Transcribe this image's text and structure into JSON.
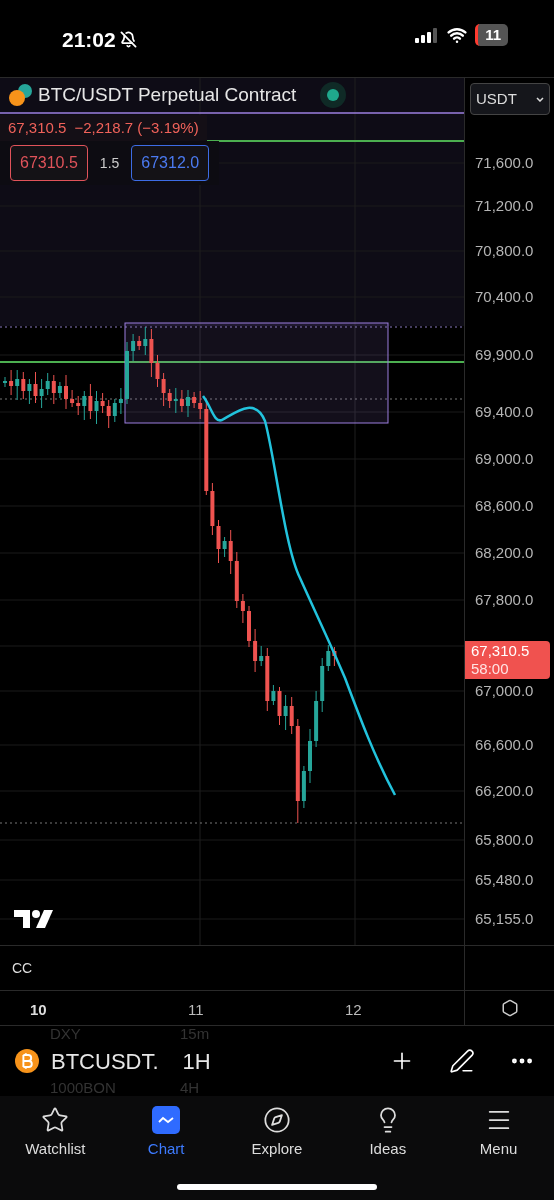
{
  "status_bar": {
    "time": "21:02",
    "battery": "11"
  },
  "chart": {
    "title": "BTC/USDT Perpetual Contract",
    "currency": "USDT",
    "last_price": "67,310.5",
    "change": "−2,218.7 (−3.19%)",
    "bid": "67310.5",
    "spread": "1.5",
    "ask": "67312.0",
    "price_ticks": [
      "71,600.0",
      "71,200.0",
      "70,800.0",
      "70,400.0",
      "69,900.0",
      "69,400.0",
      "69,000.0",
      "68,600.0",
      "68,200.0",
      "67,800.0",
      "67,000.0",
      "66,600.0",
      "66,200.0",
      "65,800.0",
      "65,480.0",
      "65,155.0"
    ],
    "price_tag": {
      "price": "67,310.5",
      "countdown": "58:00"
    },
    "indicator": "CC",
    "time_ticks": [
      {
        "label": "10",
        "bold": true
      },
      {
        "label": "11",
        "bold": false
      },
      {
        "label": "12",
        "bold": false
      }
    ]
  },
  "ghost_rows": [
    {
      "symbol": "DXY",
      "interval": "15m"
    },
    {
      "symbol": "1000BON",
      "interval": "4H"
    }
  ],
  "toolbar": {
    "symbol": "BTCUSDT.",
    "interval": "1H"
  },
  "tabs": [
    {
      "label": "Watchlist",
      "selected": false
    },
    {
      "label": "Chart",
      "selected": true
    },
    {
      "label": "Explore",
      "selected": false
    },
    {
      "label": "Ideas",
      "selected": false
    },
    {
      "label": "Menu",
      "selected": false
    }
  ]
}
